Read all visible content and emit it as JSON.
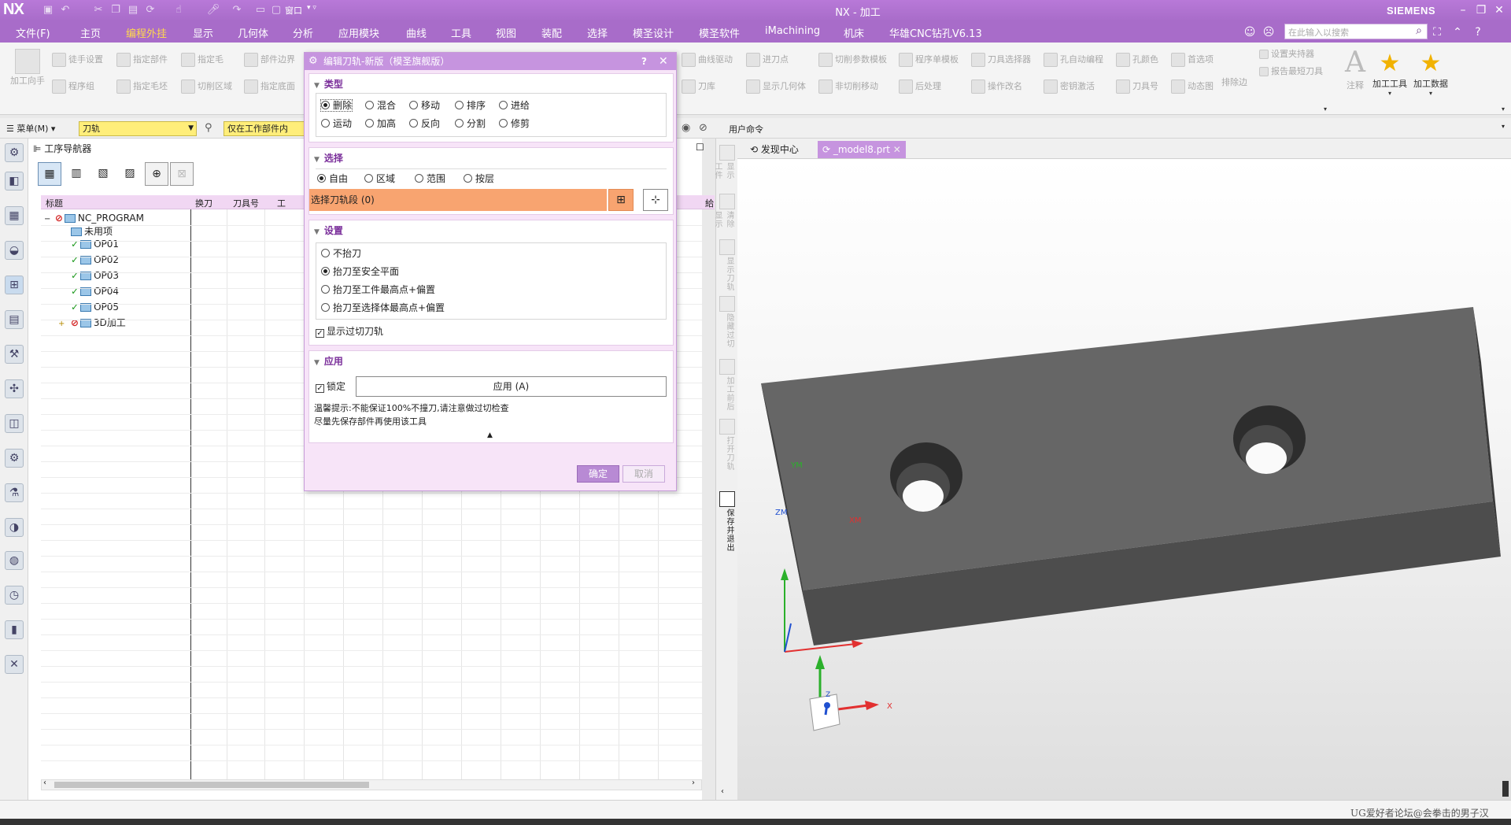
{
  "app": {
    "logo": "NX",
    "window_title": "NX - 加工",
    "brand": "SIEMENS"
  },
  "menu_tabs": [
    {
      "label": "文件(F)"
    },
    {
      "label": "主页"
    },
    {
      "label": "编程外挂",
      "active": true
    },
    {
      "label": "显示"
    },
    {
      "label": "几何体"
    },
    {
      "label": "分析"
    },
    {
      "label": "应用模块"
    },
    {
      "label": "曲线"
    },
    {
      "label": "工具"
    },
    {
      "label": "视图"
    },
    {
      "label": "装配"
    },
    {
      "label": "选择"
    },
    {
      "label": "模圣设计"
    },
    {
      "label": "模圣软件"
    },
    {
      "label": "iMachining"
    },
    {
      "label": "机床"
    },
    {
      "label": "华雄CNC钻孔V6.13"
    }
  ],
  "search_placeholder": "在此输入以搜索",
  "quick_access": {
    "window_label": "窗口"
  },
  "ribbon": {
    "row1": [
      "加工向手",
      "徒手设置",
      "指定部件",
      "指定毛",
      "部件边界"
    ],
    "row2": [
      "程序组",
      "指定毛坯",
      "切削区域",
      "指定底面"
    ],
    "right_row1": [
      "曲线驱动",
      "进刀点",
      "切削参数模板",
      "程序单模板",
      "刀具选择器",
      "孔自动编程",
      "孔颜色",
      "首选项",
      "设置夹持器"
    ],
    "right_row2": [
      "刀库",
      "显示几何体",
      "非切削移动",
      "后处理",
      "操作改名",
      "密钥激活",
      "刀具号",
      "动态图",
      "报告最短刀具"
    ],
    "mid_label": "排除边",
    "big_buttons": [
      {
        "label": "注释",
        "icon": "A"
      },
      {
        "label": "加工工具",
        "icon": "star"
      },
      {
        "label": "加工数据",
        "icon": "star"
      }
    ]
  },
  "selection_bar": {
    "menu_label": "菜单(M)",
    "filter_value": "刀轨",
    "scope_value": "仅在工作部件内",
    "user_command": "用户命令"
  },
  "navigator": {
    "title": "工序导航器",
    "columns": [
      "标题",
      "换刀",
      "刀具号",
      "工"
    ],
    "extra_column": "給",
    "rows": [
      {
        "name": "NC_PROGRAM",
        "status": "forbid",
        "indent": 0,
        "expander": "−"
      },
      {
        "name": "未用项",
        "status": "none",
        "indent": 1,
        "expander": ""
      },
      {
        "name": "OP01",
        "status": "check",
        "indent": 1,
        "expander": ""
      },
      {
        "name": "OP02",
        "status": "check",
        "indent": 1,
        "expander": ""
      },
      {
        "name": "OP03",
        "status": "check",
        "indent": 1,
        "expander": ""
      },
      {
        "name": "OP04",
        "status": "check",
        "indent": 1,
        "expander": ""
      },
      {
        "name": "OP05",
        "status": "check",
        "indent": 1,
        "expander": ""
      },
      {
        "name": "3D加工",
        "status": "forbid",
        "indent": 1,
        "expander": "+"
      }
    ]
  },
  "dialog": {
    "title": "编辑刀轨-新版（模圣旗舰版）",
    "type_section": {
      "header": "类型",
      "options_row1": [
        "删除",
        "混合",
        "移动",
        "排序",
        "进给"
      ],
      "options_row2": [
        "运动",
        "加高",
        "反向",
        "分割",
        "修剪"
      ],
      "selected": "删除"
    },
    "select_section": {
      "header": "选择",
      "options": [
        "自由",
        "区域",
        "范围",
        "按层"
      ],
      "selected": "自由",
      "select_label": "选择刀轨段 (0)"
    },
    "settings_section": {
      "header": "设置",
      "options": [
        "不抬刀",
        "抬刀至安全平面",
        "抬刀至工件最高点+偏置",
        "抬刀至选择体最高点+偏置"
      ],
      "selected": "抬刀至安全平面",
      "checkbox_label": "显示过切刀轨",
      "checkbox_checked": true
    },
    "apply_section": {
      "header": "应用",
      "lock_label": "锁定",
      "lock_checked": true,
      "apply_button": "应用 (A)",
      "hint1": "温馨提示:不能保证100%不撞刀,请注意做过切检查",
      "hint2": "尽量先保存部件再使用该工具"
    },
    "ok_button": "确定",
    "cancel_button": "取消"
  },
  "doc_tabs": [
    {
      "label": "发现中心"
    },
    {
      "label": "_model8.prt",
      "active": true
    }
  ],
  "vertical_strip": [
    "显示工件",
    "清除显示",
    "显示刀轨",
    "隐藏过切",
    "加工前后",
    "打开刀轨",
    "保存并退出"
  ],
  "viewport": {
    "axis_labels": {
      "xm": "XM",
      "ym": "YM",
      "zm": "ZM",
      "x": "X",
      "z": "Z"
    }
  },
  "watermark": "UG爱好者论坛@会拳击的男子汉",
  "colors": {
    "accent": "#a86cc9",
    "dialog_bg": "#f7e4f8",
    "selection_orange": "#f8a470",
    "combo_yellow": "#ffee7a"
  }
}
